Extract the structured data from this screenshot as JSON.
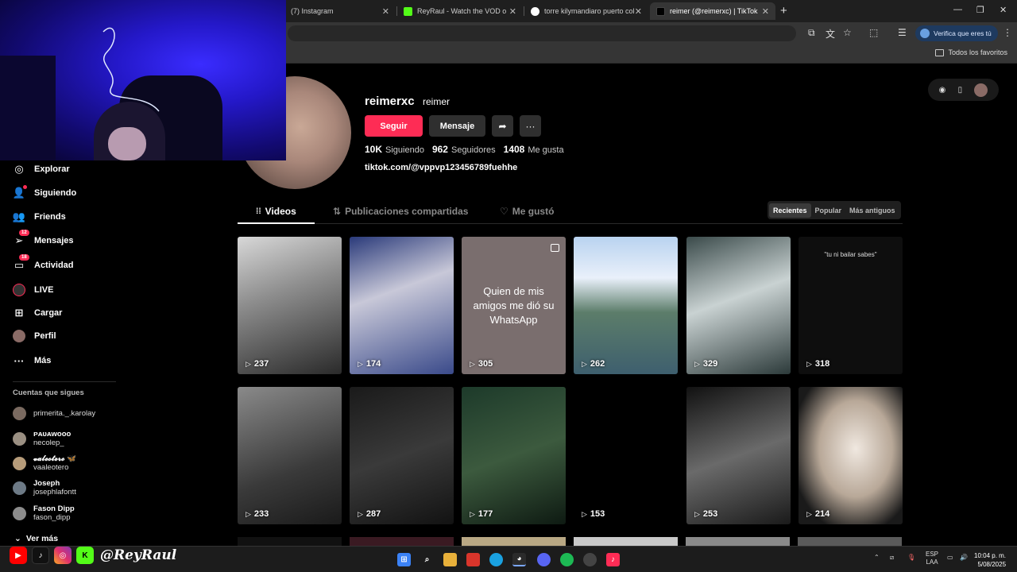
{
  "browser": {
    "tabs": [
      {
        "title": "(7) Instagram",
        "active": false
      },
      {
        "title": "ReyRaul - Watch the VOD on Ki",
        "active": false
      },
      {
        "title": "torre kilymandiaro puerto colom",
        "active": false
      },
      {
        "title": "reimer (@reimerxc) | TikTok",
        "active": true
      }
    ],
    "verify_label": "Verifica que eres tú",
    "bookmarks_label": "Todos los favoritos"
  },
  "sidebar": {
    "nav": [
      {
        "label": "Explorar",
        "icon": "compass-icon"
      },
      {
        "label": "Siguiendo",
        "icon": "following-icon"
      },
      {
        "label": "Friends",
        "icon": "friends-icon"
      },
      {
        "label": "Mensajes",
        "icon": "paper-plane-icon",
        "badge": "12"
      },
      {
        "label": "Actividad",
        "icon": "activity-icon",
        "badge": "18"
      },
      {
        "label": "LIVE",
        "icon": "live-icon"
      },
      {
        "label": "Cargar",
        "icon": "upload-icon"
      },
      {
        "label": "Perfil",
        "icon": "profile-icon"
      },
      {
        "label": "Más",
        "icon": "more-icon"
      }
    ],
    "following_title": "Cuentas que sigues",
    "following": [
      {
        "name": "",
        "handle": "primerita._.karolay",
        "color": "#7a6a60"
      },
      {
        "name": "ᴘᴀᴜᴀᴡᴏᴏᴏ",
        "handle": "necolep_",
        "color": "#9a8f82"
      },
      {
        "name": "𝓿𝓪𝓵𝓮𝓸𝓽𝓮𝓻𝓸 🦋",
        "handle": "vaaleotero",
        "color": "#b79c7a"
      },
      {
        "name": "Joseph",
        "handle": "josephlafontt",
        "color": "#6d7a86"
      },
      {
        "name": "Fason Dipp",
        "handle": "fason_dipp",
        "color": "#8c8c8c"
      }
    ],
    "see_more": "Ver más"
  },
  "profile": {
    "username": "reimerxc",
    "nickname": "reimer",
    "follow_label": "Seguir",
    "message_label": "Mensaje",
    "stats": [
      {
        "value": "10K",
        "label": "Siguiendo"
      },
      {
        "value": "962",
        "label": "Seguidores"
      },
      {
        "value": "1408",
        "label": "Me gusta"
      }
    ],
    "bio_link": "tiktok.com/@vppvp123456789fuehhe"
  },
  "tabs": [
    {
      "label": "Videos",
      "active": true
    },
    {
      "label": "Publicaciones compartidas",
      "active": false
    },
    {
      "label": "Me gustó",
      "active": false
    }
  ],
  "sort": [
    {
      "label": "Recientes",
      "active": true
    },
    {
      "label": "Popular",
      "active": false
    },
    {
      "label": "Más antiguos",
      "active": false
    }
  ],
  "videos": [
    {
      "views": "237",
      "bg": "linear-gradient(160deg,#d8d8d8 0%,#8e8e8e 40%,#2a2a2a 100%)",
      "text": "",
      "caption": ""
    },
    {
      "views": "174",
      "bg": "linear-gradient(160deg,#2a3a7a 0%,#c8c8d8 40%,#3a4a8a 100%)",
      "text": "",
      "caption": ""
    },
    {
      "views": "305",
      "bg": "#7a6e6e",
      "text": "Quien de mis amigos me dió su WhatsApp",
      "caption": ""
    },
    {
      "views": "262",
      "bg": "linear-gradient(180deg,#b9d3f0 0%,#e9f0fa 30%,#5c7d6a 55%,#3e5f6e 100%)",
      "text": "",
      "caption": ""
    },
    {
      "views": "329",
      "bg": "linear-gradient(160deg,#3a4a4a 0%,#c9d2d2 45%,#2c3a3a 100%)",
      "text": "",
      "caption": ""
    },
    {
      "views": "318",
      "bg": "#0e0e0e",
      "text": "",
      "caption": "\"tu ni bailar sabes\""
    },
    {
      "views": "233",
      "bg": "linear-gradient(160deg,#8a8a8a 0%,#3a3a3a 60%,#1a1a1a 100%)",
      "text": "",
      "caption": ""
    },
    {
      "views": "287",
      "bg": "linear-gradient(160deg,#1a1a1a 0%,#3a3a3a 50%,#121212 100%)",
      "text": "",
      "caption": ""
    },
    {
      "views": "177",
      "bg": "linear-gradient(160deg,#1d3a2a 0%,#3c5a3e 50%,#0e1a12 100%)",
      "text": "",
      "caption": ""
    },
    {
      "views": "153",
      "bg": "#000000",
      "text": "",
      "caption": ""
    },
    {
      "views": "253",
      "bg": "linear-gradient(160deg,#111 0%,#6a6a6a 50%,#1a1a1a 100%)",
      "text": "",
      "caption": ""
    },
    {
      "views": "214",
      "bg": "radial-gradient(ellipse at 55% 45%,#f0e8e0 0%,#b8a898 45%,#1a1a1a 80%)",
      "text": "",
      "caption": ""
    }
  ],
  "taskbar": {
    "lang_line1": "ESP",
    "lang_line2": "LAA",
    "time": "10:04 p. m.",
    "date": "5/08/2025"
  },
  "streamer": {
    "name": "@ReyRaul"
  },
  "colors": {
    "accent": "#fe2c55",
    "background": "#000000"
  }
}
